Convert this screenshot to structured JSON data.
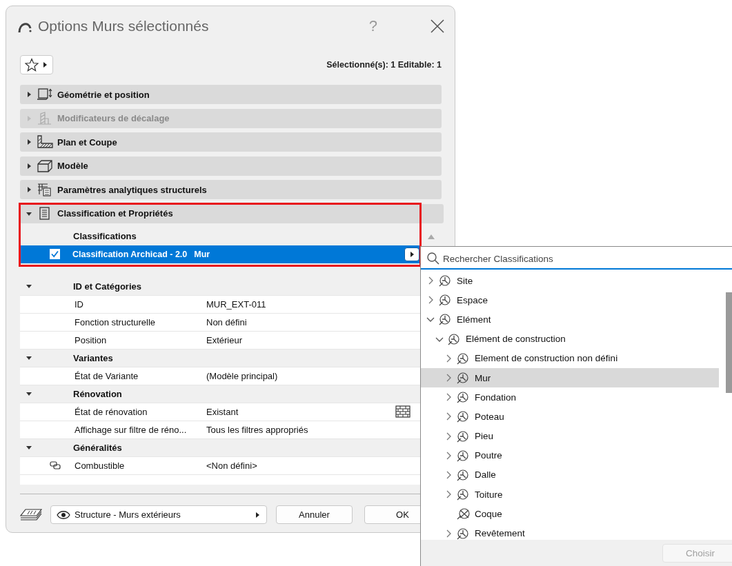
{
  "window": {
    "title": "Options Murs sélectionnés",
    "help": "?"
  },
  "toolbar": {
    "selection_info": "Sélectionné(s): 1 Editable: 1"
  },
  "panels": [
    {
      "kind": "geometry",
      "label": "Géométrie et position",
      "expanded": false,
      "disabled": false
    },
    {
      "kind": "offset",
      "label": "Modificateurs de décalage",
      "expanded": false,
      "disabled": true
    },
    {
      "kind": "plan",
      "label": "Plan et Coupe",
      "expanded": false,
      "disabled": false
    },
    {
      "kind": "model",
      "label": "Modèle",
      "expanded": false,
      "disabled": false
    },
    {
      "kind": "analytic",
      "label": "Paramètres analytiques structurels",
      "expanded": false,
      "disabled": false
    },
    {
      "kind": "classification",
      "label": "Classification et Propriétés",
      "expanded": true,
      "disabled": false
    }
  ],
  "classifications": {
    "highlighted": true,
    "heading": "Classifications",
    "rows": [
      {
        "checked": true,
        "system": "Classification Archicad - 2.0",
        "value": "Mur",
        "selected": true
      }
    ]
  },
  "properties": [
    {
      "title": "ID et Catégories",
      "expanded": true,
      "rows": [
        {
          "kind": "plain",
          "label": "ID",
          "value": "MUR_EXT-011"
        },
        {
          "kind": "plain",
          "label": "Fonction structurelle",
          "value": "Non défini"
        },
        {
          "kind": "plain",
          "label": "Position",
          "value": "Extérieur"
        }
      ]
    },
    {
      "title": "Variantes",
      "expanded": true,
      "rows": [
        {
          "kind": "plain",
          "label": "État de Variante",
          "value": "(Modèle principal)"
        }
      ]
    },
    {
      "title": "Rénovation",
      "expanded": true,
      "rows": [
        {
          "kind": "status",
          "label": "État de rénovation",
          "value": "Existant"
        },
        {
          "kind": "plain",
          "label": "Affichage sur filtre de réno...",
          "value": "Tous les filtres appropriés"
        }
      ]
    },
    {
      "title": "Généralités",
      "expanded": true,
      "rows": [
        {
          "kind": "linked",
          "label": "Combustible",
          "value": "<Non défini>"
        }
      ]
    }
  ],
  "footer": {
    "layer": "Structure - Murs extérieurs",
    "buttons": [
      "Annuler",
      "OK"
    ]
  },
  "classification_picker": {
    "search": {
      "placeholder": "Rechercher Classifications"
    },
    "tree": [
      {
        "kind": "branch",
        "label": "Site",
        "expanded": false,
        "selected": false
      },
      {
        "kind": "branch",
        "label": "Espace",
        "expanded": false,
        "selected": false
      },
      {
        "kind": "branch",
        "label": "Elément",
        "expanded": true,
        "selected": false,
        "children": [
          {
            "kind": "branch",
            "label": "Elément de construction",
            "expanded": true,
            "selected": false,
            "children": [
              {
                "kind": "branch",
                "label": "Element de construction non défini",
                "expanded": false,
                "selected": false
              },
              {
                "kind": "branch",
                "label": "Mur",
                "expanded": false,
                "selected": true
              },
              {
                "kind": "branch",
                "label": "Fondation",
                "expanded": false,
                "selected": false
              },
              {
                "kind": "branch",
                "label": "Poteau",
                "expanded": false,
                "selected": false
              },
              {
                "kind": "branch",
                "label": "Pieu",
                "expanded": false,
                "selected": false
              },
              {
                "kind": "branch",
                "label": "Poutre",
                "expanded": false,
                "selected": false
              },
              {
                "kind": "branch",
                "label": "Dalle",
                "expanded": false,
                "selected": false
              },
              {
                "kind": "branch",
                "label": "Toiture",
                "expanded": false,
                "selected": false
              },
              {
                "kind": "leaf",
                "label": "Coque",
                "selected": false
              },
              {
                "kind": "branch",
                "label": "Revêtement",
                "expanded": false,
                "selected": false
              }
            ]
          }
        ]
      }
    ],
    "button": {
      "label": "Choisir",
      "disabled": true
    }
  }
}
